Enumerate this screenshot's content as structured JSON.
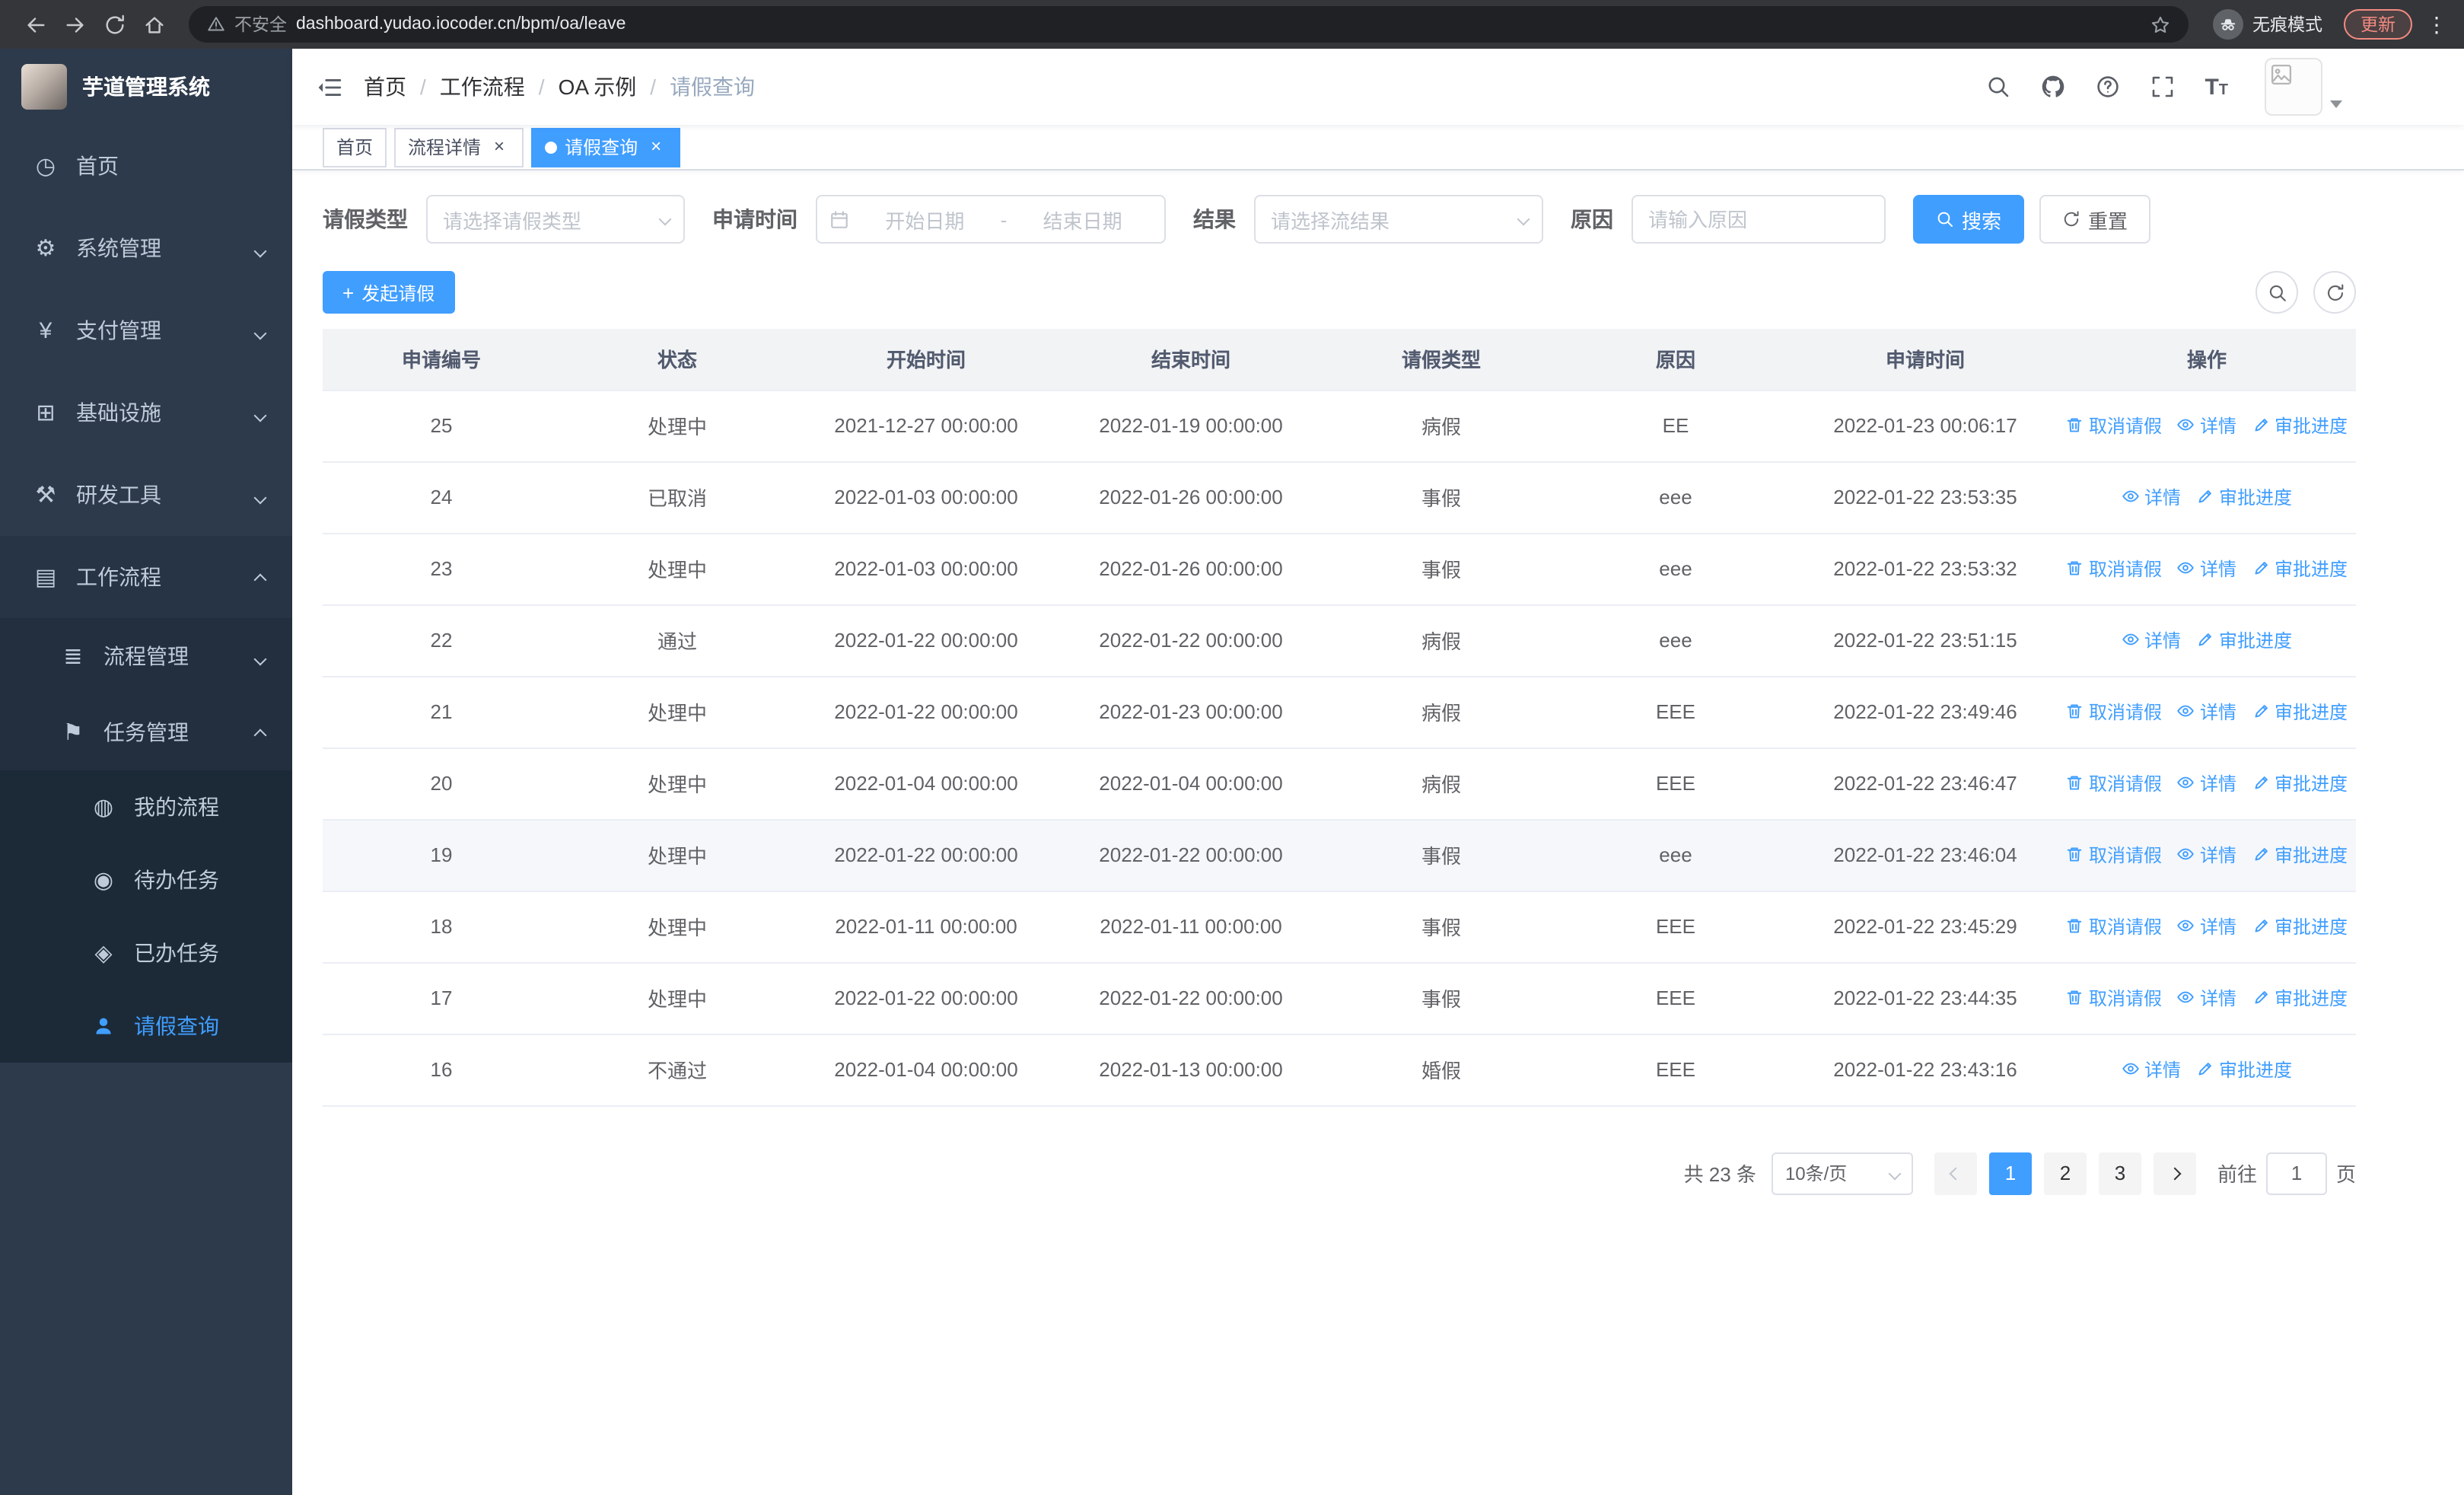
{
  "browser": {
    "security_label": "不安全",
    "url": "dashboard.yudao.iocoder.cn/bpm/oa/leave",
    "incognito_label": "无痕模式",
    "update_label": "更新"
  },
  "app_title": "芋道管理系统",
  "sidebar": {
    "items": [
      {
        "label": "首页",
        "icon": "dashboard-icon"
      },
      {
        "label": "系统管理",
        "icon": "gear-icon"
      },
      {
        "label": "支付管理",
        "icon": "yen-icon"
      },
      {
        "label": "基础设施",
        "icon": "infrastructure-icon"
      },
      {
        "label": "研发工具",
        "icon": "tools-icon"
      },
      {
        "label": "工作流程",
        "icon": "workflow-icon"
      },
      {
        "label": "流程管理",
        "icon": "process-icon"
      },
      {
        "label": "任务管理",
        "icon": "task-icon"
      },
      {
        "label": "我的流程",
        "icon": "my-process-icon"
      },
      {
        "label": "待办任务",
        "icon": "todo-icon"
      },
      {
        "label": "已办任务",
        "icon": "done-icon"
      },
      {
        "label": "请假查询",
        "icon": "person-icon"
      }
    ]
  },
  "breadcrumb": {
    "separator": "/",
    "items": [
      "首页",
      "工作流程",
      "OA 示例",
      "请假查询"
    ]
  },
  "tabs": [
    {
      "label": "首页",
      "closable": false,
      "active": false
    },
    {
      "label": "流程详情",
      "closable": true,
      "active": false
    },
    {
      "label": "请假查询",
      "closable": true,
      "active": true
    }
  ],
  "filters": {
    "leave_type": {
      "label": "请假类型",
      "placeholder": "请选择请假类型"
    },
    "apply_time": {
      "label": "申请时间",
      "start_placeholder": "开始日期",
      "separator": "-",
      "end_placeholder": "结束日期"
    },
    "result": {
      "label": "结果",
      "placeholder": "请选择流结果"
    },
    "reason": {
      "label": "原因",
      "placeholder": "请输入原因"
    },
    "search_label": "搜索",
    "reset_label": "重置"
  },
  "toolbar": {
    "create_label": "发起请假"
  },
  "table": {
    "columns": [
      "申请编号",
      "状态",
      "开始时间",
      "结束时间",
      "请假类型",
      "原因",
      "申请时间",
      "操作"
    ],
    "action_labels": {
      "cancel": "取消请假",
      "detail": "详情",
      "progress": "审批进度"
    },
    "rows": [
      {
        "id": "25",
        "status": "处理中",
        "start": "2021-12-27 00:00:00",
        "end": "2022-01-19 00:00:00",
        "type": "病假",
        "reason": "EE",
        "applied": "2022-01-23 00:06:17",
        "actions": [
          "cancel",
          "detail",
          "progress"
        ]
      },
      {
        "id": "24",
        "status": "已取消",
        "start": "2022-01-03 00:00:00",
        "end": "2022-01-26 00:00:00",
        "type": "事假",
        "reason": "eee",
        "applied": "2022-01-22 23:53:35",
        "actions": [
          "detail",
          "progress"
        ]
      },
      {
        "id": "23",
        "status": "处理中",
        "start": "2022-01-03 00:00:00",
        "end": "2022-01-26 00:00:00",
        "type": "事假",
        "reason": "eee",
        "applied": "2022-01-22 23:53:32",
        "actions": [
          "cancel",
          "detail",
          "progress"
        ]
      },
      {
        "id": "22",
        "status": "通过",
        "start": "2022-01-22 00:00:00",
        "end": "2022-01-22 00:00:00",
        "type": "病假",
        "reason": "eee",
        "applied": "2022-01-22 23:51:15",
        "actions": [
          "detail",
          "progress"
        ]
      },
      {
        "id": "21",
        "status": "处理中",
        "start": "2022-01-22 00:00:00",
        "end": "2022-01-23 00:00:00",
        "type": "病假",
        "reason": "EEE",
        "applied": "2022-01-22 23:49:46",
        "actions": [
          "cancel",
          "detail",
          "progress"
        ]
      },
      {
        "id": "20",
        "status": "处理中",
        "start": "2022-01-04 00:00:00",
        "end": "2022-01-04 00:00:00",
        "type": "病假",
        "reason": "EEE",
        "applied": "2022-01-22 23:46:47",
        "actions": [
          "cancel",
          "detail",
          "progress"
        ]
      },
      {
        "id": "19",
        "status": "处理中",
        "start": "2022-01-22 00:00:00",
        "end": "2022-01-22 00:00:00",
        "type": "事假",
        "reason": "eee",
        "applied": "2022-01-22 23:46:04",
        "actions": [
          "cancel",
          "detail",
          "progress"
        ],
        "highlighted": true
      },
      {
        "id": "18",
        "status": "处理中",
        "start": "2022-01-11 00:00:00",
        "end": "2022-01-11 00:00:00",
        "type": "事假",
        "reason": "EEE",
        "applied": "2022-01-22 23:45:29",
        "actions": [
          "cancel",
          "detail",
          "progress"
        ]
      },
      {
        "id": "17",
        "status": "处理中",
        "start": "2022-01-22 00:00:00",
        "end": "2022-01-22 00:00:00",
        "type": "事假",
        "reason": "EEE",
        "applied": "2022-01-22 23:44:35",
        "actions": [
          "cancel",
          "detail",
          "progress"
        ]
      },
      {
        "id": "16",
        "status": "不通过",
        "start": "2022-01-04 00:00:00",
        "end": "2022-01-13 00:00:00",
        "type": "婚假",
        "reason": "EEE",
        "applied": "2022-01-22 23:43:16",
        "actions": [
          "detail",
          "progress"
        ]
      }
    ]
  },
  "pagination": {
    "total_label": "共 23 条",
    "page_size": "10条/页",
    "pages": [
      "1",
      "2",
      "3"
    ],
    "active_page": "1",
    "goto_label": "前往",
    "goto_value": "1",
    "page_suffix": "页"
  },
  "colors": {
    "accent": "#409EFF",
    "sidebar_bg": "#2d3a4b",
    "table_header_bg": "#f2f3f5"
  }
}
